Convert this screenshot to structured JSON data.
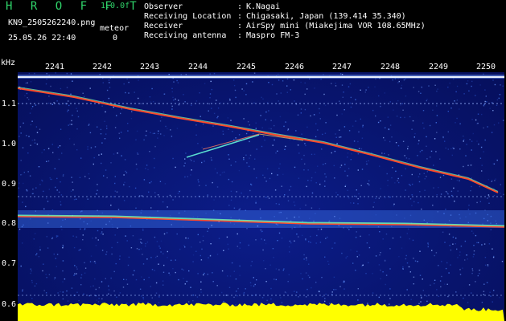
{
  "header": {
    "title": "H R O F F T",
    "version": "1.0.0f",
    "file_name": "KN9_2505262240.png",
    "meteor_label": "meteor",
    "meteor_count": "0",
    "timestamp": "25.05.26 22:40"
  },
  "metadata": [
    {
      "key": "Observer",
      "value": "K.Nagai"
    },
    {
      "key": "Receiving Location",
      "value": "Chigasaki, Japan (139.414 35.340)"
    },
    {
      "key": "Receiver",
      "value": "AirSpy mini (Miakejima VOR 108.65MHz)"
    },
    {
      "key": "Receiving antenna",
      "value": "Maspro FM-3"
    }
  ],
  "colon": ":",
  "spectrogram": {
    "y_unit": "kHz",
    "y_ticks": [
      "1.1",
      "1.0",
      "0.9",
      "0.8",
      "0.7",
      "0.6"
    ],
    "x_ticks": [
      "2241",
      "2242",
      "2243",
      "2244",
      "2245",
      "2246",
      "2247",
      "2248",
      "2249",
      "2250"
    ],
    "colors": {
      "background": "#081570",
      "noise_light": "#3f6fe0",
      "carrier": "#ff4a2a",
      "ground_level": "#ffff00",
      "grid_line": "#9ab6ff"
    }
  }
}
